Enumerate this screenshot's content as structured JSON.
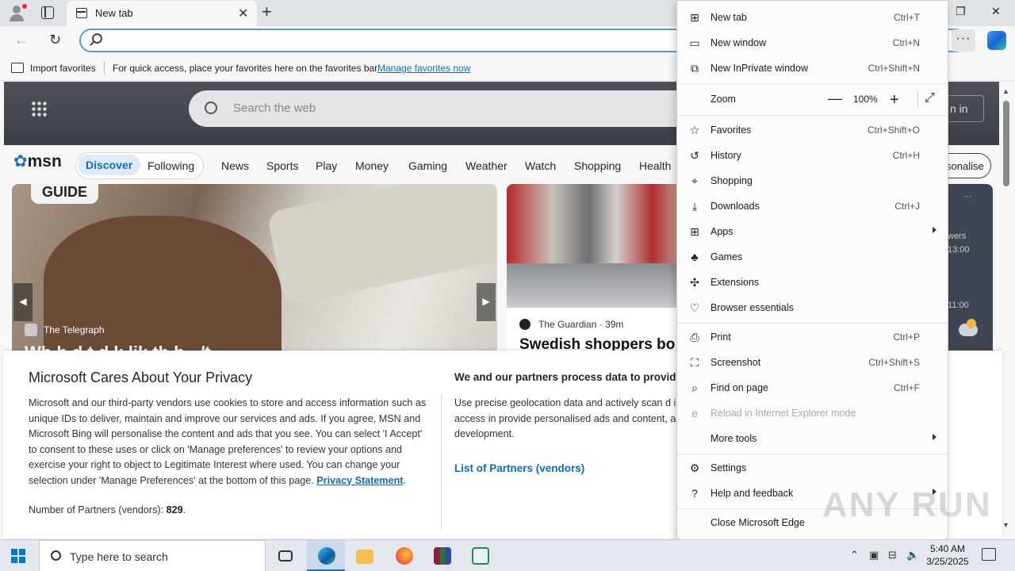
{
  "browser": {
    "tab": {
      "title": "New tab"
    },
    "window_controls": {
      "minimize": "—",
      "maximize": "❐",
      "close": "✕"
    },
    "address": {
      "value": "",
      "placeholder": ""
    },
    "favorites_bar": {
      "import_label": "Import favorites",
      "hint": "For quick access, place your favorites here on the favorites bar.",
      "manage_link": "Manage favorites now"
    }
  },
  "msn": {
    "search_placeholder": "Search the web",
    "sign_in": "n in",
    "logo": {
      "brand": "msn"
    },
    "nav": {
      "discover": "Discover",
      "following": "Following",
      "items": [
        "News",
        "Sports",
        "Play",
        "Money",
        "Gaming",
        "Weather",
        "Watch",
        "Shopping",
        "Health"
      ]
    },
    "personalise": "sonalise",
    "card_left": {
      "badge": "GUIDE",
      "source": "The Telegraph",
      "headline_cut": "Wh     b  d        t  d  k  lik   th    b  ·  /t"
    },
    "card_mid": {
      "source": "The Guardian · 39m",
      "headline": "Swedish shoppers bo"
    },
    "card_right": {
      "line1": "wers",
      "line2": "13:00",
      "line3": "11:00",
      "more": "···"
    }
  },
  "privacy": {
    "title": "Microsoft Cares About Your Privacy",
    "body": "Microsoft and our third-party vendors use cookies to store and access information such as unique IDs to deliver, maintain and improve our services and ads. If you agree, MSN and Microsoft Bing will personalise the content and ads that you see. You can select 'I Accept' to consent to these uses or click on 'Manage preferences' to review your options and exercise your right to object to Legitimate Interest where used.  You can change your selection under 'Manage Preferences' at the bottom of this page.",
    "statement_link": "Privacy Statement",
    "partners_label": "Number of Partners (vendors):",
    "partners_count": "829",
    "right_title": "We and our partners process data to provide:",
    "right_body": "Use precise geolocation data and actively scan d identification. This is done to store and access in provide personalised ads and content, ad and c audience insights and product development.",
    "vendors_link": "List of Partners (vendors)"
  },
  "menu": {
    "items": [
      {
        "label": "New tab",
        "shortcut": "Ctrl+T",
        "icon": "new-tab-icon"
      },
      {
        "label": "New window",
        "shortcut": "Ctrl+N",
        "icon": "window-icon"
      },
      {
        "label": "New InPrivate window",
        "shortcut": "Ctrl+Shift+N",
        "icon": "inprivate-icon"
      },
      {
        "label": "Zoom",
        "value": "100%",
        "icon": ""
      },
      {
        "label": "Favorites",
        "shortcut": "Ctrl+Shift+O",
        "icon": "star-icon"
      },
      {
        "label": "History",
        "shortcut": "Ctrl+H",
        "icon": "history-icon"
      },
      {
        "label": "Shopping",
        "shortcut": "",
        "icon": "tag-icon"
      },
      {
        "label": "Downloads",
        "shortcut": "Ctrl+J",
        "icon": "download-icon"
      },
      {
        "label": "Apps",
        "shortcut": "",
        "icon": "apps-icon"
      },
      {
        "label": "Games",
        "shortcut": "",
        "icon": "games-icon"
      },
      {
        "label": "Extensions",
        "shortcut": "",
        "icon": "puzzle-icon"
      },
      {
        "label": "Browser essentials",
        "shortcut": "",
        "icon": "heart-pulse-icon"
      },
      {
        "label": "Print",
        "shortcut": "Ctrl+P",
        "icon": "printer-icon"
      },
      {
        "label": "Screenshot",
        "shortcut": "Ctrl+Shift+S",
        "icon": "screenshot-icon"
      },
      {
        "label": "Find on page",
        "shortcut": "Ctrl+F",
        "icon": "find-icon"
      },
      {
        "label": "Reload in Internet Explorer mode",
        "shortcut": "",
        "icon": "ie-icon"
      },
      {
        "label": "More tools",
        "shortcut": "",
        "icon": ""
      },
      {
        "label": "Settings",
        "shortcut": "",
        "icon": "gear-icon"
      },
      {
        "label": "Help and feedback",
        "shortcut": "",
        "icon": "help-icon"
      },
      {
        "label": "Close Microsoft Edge",
        "shortcut": "",
        "icon": ""
      }
    ]
  },
  "watermark": "ANY RUN",
  "taskbar": {
    "search_placeholder": "Type here to search",
    "time": "5:40 AM",
    "date": "3/25/2025"
  },
  "colors": {
    "accent": "#0f6cbd",
    "address_focus": "#5b9bd5",
    "taskbar": "#e3e8ee"
  }
}
